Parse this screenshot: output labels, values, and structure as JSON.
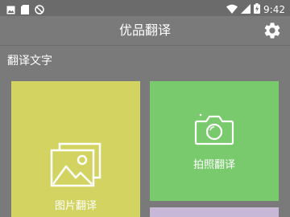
{
  "status_bar": {
    "time": "9:42",
    "icons": [
      "image-icon",
      "sd-card-icon",
      "blocked-icon",
      "wifi-icon",
      "signal-icon",
      "battery-charging-icon"
    ]
  },
  "app_bar": {
    "title": "优品翻译",
    "settings_icon": "gear-icon"
  },
  "section": {
    "title": "翻译文字"
  },
  "tiles": [
    {
      "label": "图片翻译",
      "icon": "pictures-icon",
      "color": "#d2d361"
    },
    {
      "label": "拍照翻译",
      "icon": "camera-icon",
      "color": "#79c96d"
    },
    {
      "label": "",
      "icon": "",
      "color": "#c8b8d8"
    }
  ]
}
